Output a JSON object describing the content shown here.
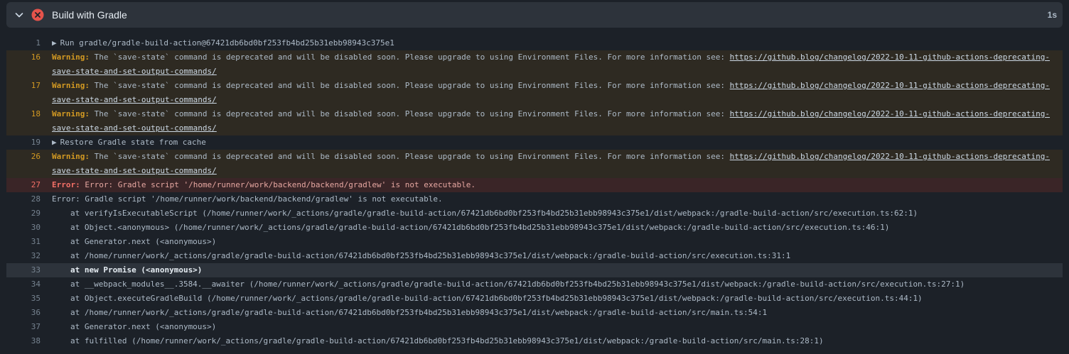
{
  "step": {
    "title": "Build with Gradle",
    "duration": "1s",
    "status_icon": "x-circle-fill-icon",
    "expand_icon": "chevron-down-icon",
    "colors": {
      "error": "#e5534b",
      "warning": "#d29922"
    }
  },
  "log": {
    "lines": {
      "l1": {
        "num": "1",
        "text": "Run gradle/gradle-build-action@67421db6bd0bf253fb4bd25b31ebb98943c375e1"
      },
      "l16": {
        "num": "16",
        "label": "Warning:",
        "text": " The `save-state` command is deprecated and will be disabled soon. Please upgrade to using Environment Files. For more information see: ",
        "link": "https://github.blog/changelog/2022-10-11-github-actions-deprecating-save-state-and-set-output-commands/"
      },
      "l17": {
        "num": "17",
        "label": "Warning:",
        "text": " The `save-state` command is deprecated and will be disabled soon. Please upgrade to using Environment Files. For more information see: ",
        "link": "https://github.blog/changelog/2022-10-11-github-actions-deprecating-save-state-and-set-output-commands/"
      },
      "l18": {
        "num": "18",
        "label": "Warning:",
        "text": " The `save-state` command is deprecated and will be disabled soon. Please upgrade to using Environment Files. For more information see: ",
        "link": "https://github.blog/changelog/2022-10-11-github-actions-deprecating-save-state-and-set-output-commands/"
      },
      "l19": {
        "num": "19",
        "text": "Restore Gradle state from cache"
      },
      "l26": {
        "num": "26",
        "label": "Warning:",
        "text": " The `save-state` command is deprecated and will be disabled soon. Please upgrade to using Environment Files. For more information see: ",
        "link": "https://github.blog/changelog/2022-10-11-github-actions-deprecating-save-state-and-set-output-commands/"
      },
      "l27": {
        "num": "27",
        "label": "Error:",
        "text": " Error: Gradle script '/home/runner/work/backend/backend/gradlew' is not executable."
      },
      "l28": {
        "num": "28",
        "text": "Error: Gradle script '/home/runner/work/backend/backend/gradlew' is not executable."
      },
      "l29": {
        "num": "29",
        "text": "at verifyIsExecutableScript (/home/runner/work/_actions/gradle/gradle-build-action/67421db6bd0bf253fb4bd25b31ebb98943c375e1/dist/webpack:/gradle-build-action/src/execution.ts:62:1)"
      },
      "l30": {
        "num": "30",
        "text": "at Object.<anonymous> (/home/runner/work/_actions/gradle/gradle-build-action/67421db6bd0bf253fb4bd25b31ebb98943c375e1/dist/webpack:/gradle-build-action/src/execution.ts:46:1)"
      },
      "l31": {
        "num": "31",
        "text": "at Generator.next (<anonymous>)"
      },
      "l32": {
        "num": "32",
        "text": "at /home/runner/work/_actions/gradle/gradle-build-action/67421db6bd0bf253fb4bd25b31ebb98943c375e1/dist/webpack:/gradle-build-action/src/execution.ts:31:1"
      },
      "l33": {
        "num": "33",
        "text": "at new Promise (<anonymous>)"
      },
      "l34": {
        "num": "34",
        "text": "at __webpack_modules__.3584.__awaiter (/home/runner/work/_actions/gradle/gradle-build-action/67421db6bd0bf253fb4bd25b31ebb98943c375e1/dist/webpack:/gradle-build-action/src/execution.ts:27:1)"
      },
      "l35": {
        "num": "35",
        "text": "at Object.executeGradleBuild (/home/runner/work/_actions/gradle/gradle-build-action/67421db6bd0bf253fb4bd25b31ebb98943c375e1/dist/webpack:/gradle-build-action/src/execution.ts:44:1)"
      },
      "l36": {
        "num": "36",
        "text": "at /home/runner/work/_actions/gradle/gradle-build-action/67421db6bd0bf253fb4bd25b31ebb98943c375e1/dist/webpack:/gradle-build-action/src/main.ts:54:1"
      },
      "l37": {
        "num": "37",
        "text": "at Generator.next (<anonymous>)"
      },
      "l38": {
        "num": "38",
        "text": "at fulfilled (/home/runner/work/_actions/gradle/gradle-build-action/67421db6bd0bf253fb4bd25b31ebb98943c375e1/dist/webpack:/gradle-build-action/src/main.ts:28:1)"
      }
    }
  }
}
